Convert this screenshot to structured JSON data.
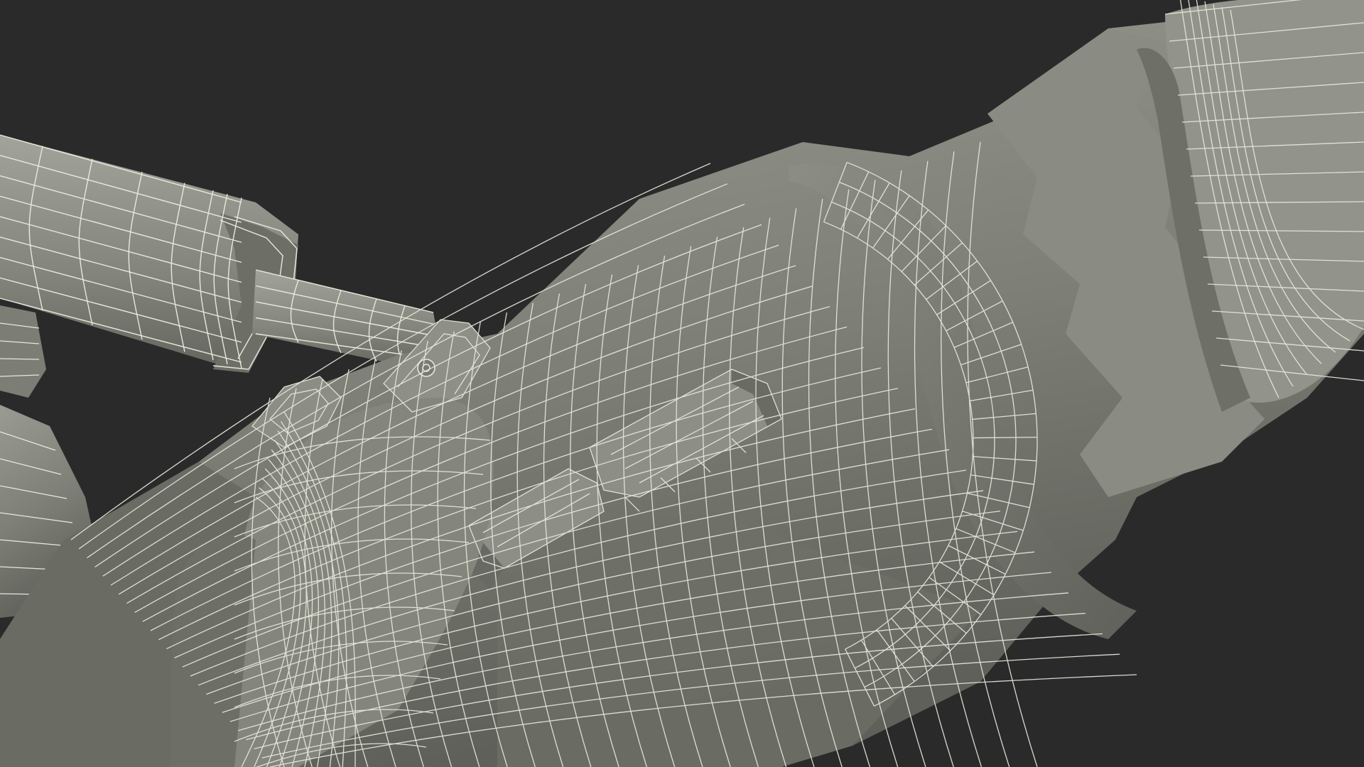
{
  "scene": {
    "background_color": "#2a2a2a",
    "mesh_fill_light": "#8f9087",
    "mesh_fill_mid": "#797a71",
    "mesh_fill_dark": "#5c5d56",
    "wire_color": "#e8e8dc",
    "subject": "wireframe-3d-model-mechanical-assembly"
  }
}
